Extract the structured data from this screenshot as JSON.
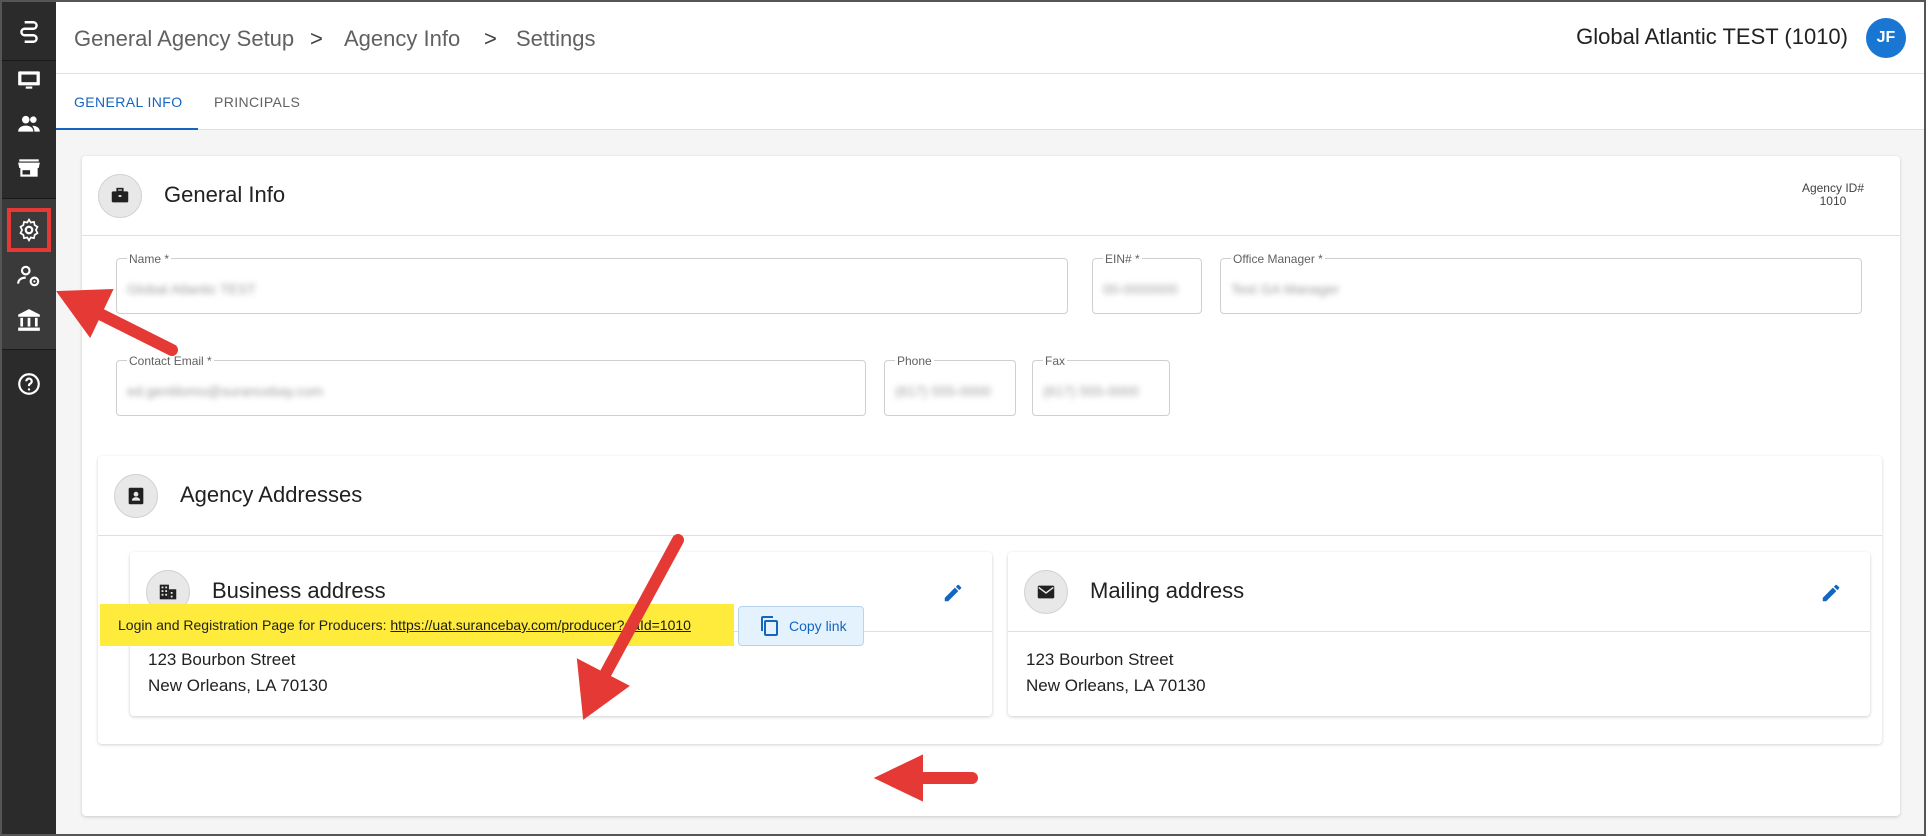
{
  "sidebar": {
    "items": [
      {
        "icon": "logo-icon"
      },
      {
        "icon": "monitor-icon"
      },
      {
        "icon": "people-icon"
      },
      {
        "icon": "store-icon"
      },
      {
        "icon": "gear-icon"
      },
      {
        "icon": "user-gear-icon"
      },
      {
        "icon": "bank-icon"
      },
      {
        "icon": "help-icon"
      }
    ]
  },
  "header": {
    "breadcrumb": [
      "General Agency Setup",
      "Agency Info",
      "Settings"
    ],
    "separator": ">",
    "agency_name": "Global Atlantic TEST (1010)",
    "avatar_initials": "JF"
  },
  "tabs": [
    {
      "label": "GENERAL INFO",
      "active": true
    },
    {
      "label": "PRINCIPALS",
      "active": false
    }
  ],
  "general_info": {
    "title": "General Info",
    "agency_id_label": "Agency ID#",
    "agency_id_value": "1010",
    "fields": {
      "name": {
        "label": "Name *",
        "value": "Global Atlantic TEST"
      },
      "ein": {
        "label": "EIN# *",
        "value": "00-0000000"
      },
      "office_manager": {
        "label": "Office Manager *",
        "value": "Test GA Manager"
      },
      "contact_email": {
        "label": "Contact Email *",
        "value": "ed.gentilomo@surancebay.com"
      },
      "phone": {
        "label": "Phone",
        "value": "(617) 555-0000"
      },
      "fax": {
        "label": "Fax",
        "value": "(617) 555-0000"
      }
    }
  },
  "addresses": {
    "title": "Agency Addresses",
    "business": {
      "title": "Business address",
      "line1": "123 Bourbon Street",
      "line2": "New Orleans, LA 70130"
    },
    "mailing": {
      "title": "Mailing address",
      "line1": "123 Bourbon Street",
      "line2": "New Orleans, LA 70130"
    }
  },
  "registration": {
    "label": "Login and Registration Page for Producers:",
    "url": "https://uat.surancebay.com/producer?gaId=1010",
    "copy_label": "Copy link"
  },
  "colors": {
    "sidebar": "#2b2b2b",
    "accent": "#1565c0",
    "highlight": "#ffeb3b",
    "annotation": "#e53935"
  }
}
